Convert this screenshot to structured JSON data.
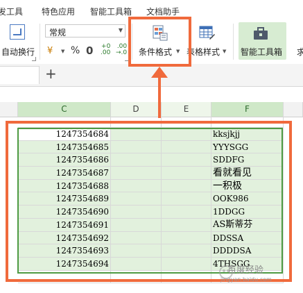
{
  "ribbon_tabs": {
    "developer": "发工具",
    "features": "特色应用",
    "smart_toolbox": "智能工具箱",
    "doc_assist": "文档助手"
  },
  "ribbon": {
    "wrap_text": "自动换行",
    "number_format": "常规",
    "currency_symbol": "¥",
    "percent": "%",
    "thousands": "0",
    "increase_decimal": "+0\n.00",
    "decrease_decimal": ".00\n→.0",
    "conditional_format": "条件格式",
    "table_style": "表格样式",
    "smart_toolbox": "智能工具箱",
    "cut_off_label": "求"
  },
  "sheet_tabs": {
    "add_symbol": "+"
  },
  "columns": [
    "C",
    "D",
    "E",
    "F"
  ],
  "rows": [
    {
      "c": "1247354684",
      "f": "kksjkjj"
    },
    {
      "c": "1247354685",
      "f": "YYYSGG"
    },
    {
      "c": "1247354686",
      "f": "SDDFG"
    },
    {
      "c": "1247354687",
      "f": "看就看见"
    },
    {
      "c": "1247354688",
      "f": "一积极"
    },
    {
      "c": "1247354689",
      "f": "OOK986"
    },
    {
      "c": "1247354690",
      "f": "1DDGG"
    },
    {
      "c": "1247354691",
      "f": "AS斯蒂芬"
    },
    {
      "c": "1247354692",
      "f": "DDSSA"
    },
    {
      "c": "1247354693",
      "f": "DDDDSA"
    },
    {
      "c": "1247354694",
      "f": "4THSGG"
    }
  ],
  "watermark": {
    "text": "百度经验",
    "sub": "jingyan.baidu.com"
  },
  "colors": {
    "highlight": "#f06a3c",
    "selection_fill": "#e2f1dd",
    "selection_border": "#4e9a42",
    "toolbox_active": "#d7ecd2"
  }
}
